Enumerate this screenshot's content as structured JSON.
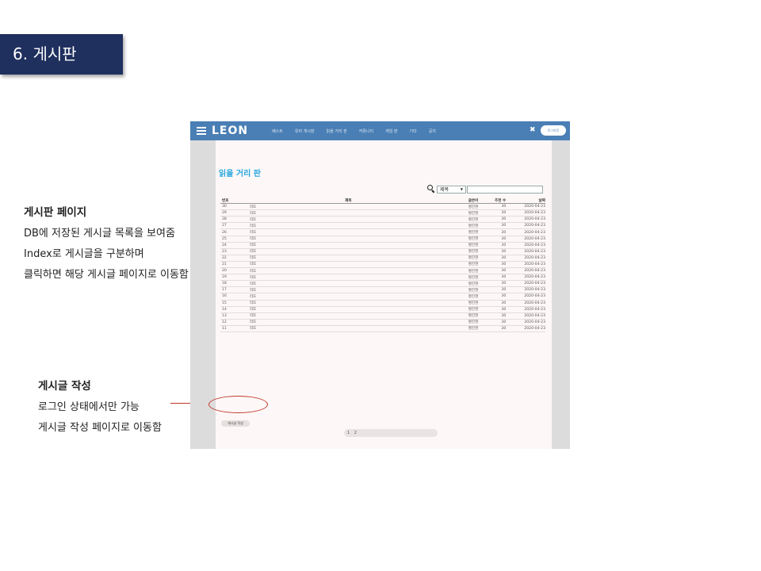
{
  "slide_title": "6. 게시판",
  "note1": {
    "heading": "게시판 페이지",
    "lines": [
      "DB에 저장된 게시글 목록을 보여줌",
      "Index로 게시글을 구분하며",
      "클릭하면 해당 게시글 페이지로 이동함"
    ]
  },
  "note2": {
    "heading": "게시글 작성",
    "lines": [
      "로그인 상태에서만 가능",
      "게시글 작성 페이지로 이동함"
    ]
  },
  "app": {
    "logo": "LEON",
    "menu": [
      "베스트",
      "유머 게시판",
      "읽을 거리 판",
      "커뮤니티",
      "게임 판",
      "기타",
      "공지"
    ],
    "login_label": "로그아웃",
    "board_title": "읽을 거리 판",
    "search_select_value": "제목",
    "columns": [
      "번호",
      "제목",
      "글쓴이",
      "추천 수",
      "날짜"
    ],
    "rows": [
      [
        "30",
        "리뜨",
        "명진현",
        "30",
        "2020-04-23"
      ],
      [
        "29",
        "리뜨",
        "명진현",
        "30",
        "2020-04-23"
      ],
      [
        "28",
        "리뜨",
        "명진현",
        "30",
        "2020-04-23"
      ],
      [
        "27",
        "리뜨",
        "명진현",
        "30",
        "2020-04-23"
      ],
      [
        "26",
        "리뜨",
        "명진현",
        "30",
        "2020-04-23"
      ],
      [
        "25",
        "리뜨",
        "명진현",
        "30",
        "2020-04-23"
      ],
      [
        "24",
        "리뜨",
        "명진현",
        "30",
        "2020-04-23"
      ],
      [
        "23",
        "리뜨",
        "명진현",
        "30",
        "2020-04-23"
      ],
      [
        "22",
        "리뜨",
        "명진현",
        "30",
        "2020-04-23"
      ],
      [
        "21",
        "리뜨",
        "명진현",
        "30",
        "2020-04-23"
      ],
      [
        "20",
        "리뜨",
        "명진현",
        "30",
        "2020-04-23"
      ],
      [
        "19",
        "리뜨",
        "명진현",
        "30",
        "2020-04-23"
      ],
      [
        "18",
        "리뜨",
        "명진현",
        "30",
        "2020-04-23"
      ],
      [
        "17",
        "리뜨",
        "명진현",
        "30",
        "2020-04-23"
      ],
      [
        "16",
        "리뜨",
        "명진현",
        "30",
        "2020-04-23"
      ],
      [
        "15",
        "리뜨",
        "명진현",
        "30",
        "2020-04-23"
      ],
      [
        "14",
        "리뜨",
        "명진현",
        "30",
        "2020-04-23"
      ],
      [
        "13",
        "리뜨",
        "명진현",
        "30",
        "2020-04-23"
      ],
      [
        "12",
        "리뜨",
        "명진현",
        "30",
        "2020-04-23"
      ],
      [
        "11",
        "리뜨",
        "명진현",
        "30",
        "2020-04-23"
      ]
    ],
    "write_button": "게시글 작성",
    "pages": [
      "1",
      "2"
    ]
  },
  "colors": {
    "title_bar": "#1f2f5e",
    "navbar": "#4a7fb5",
    "board_title": "#29a7e0",
    "annotation_line": "#c0392b"
  }
}
